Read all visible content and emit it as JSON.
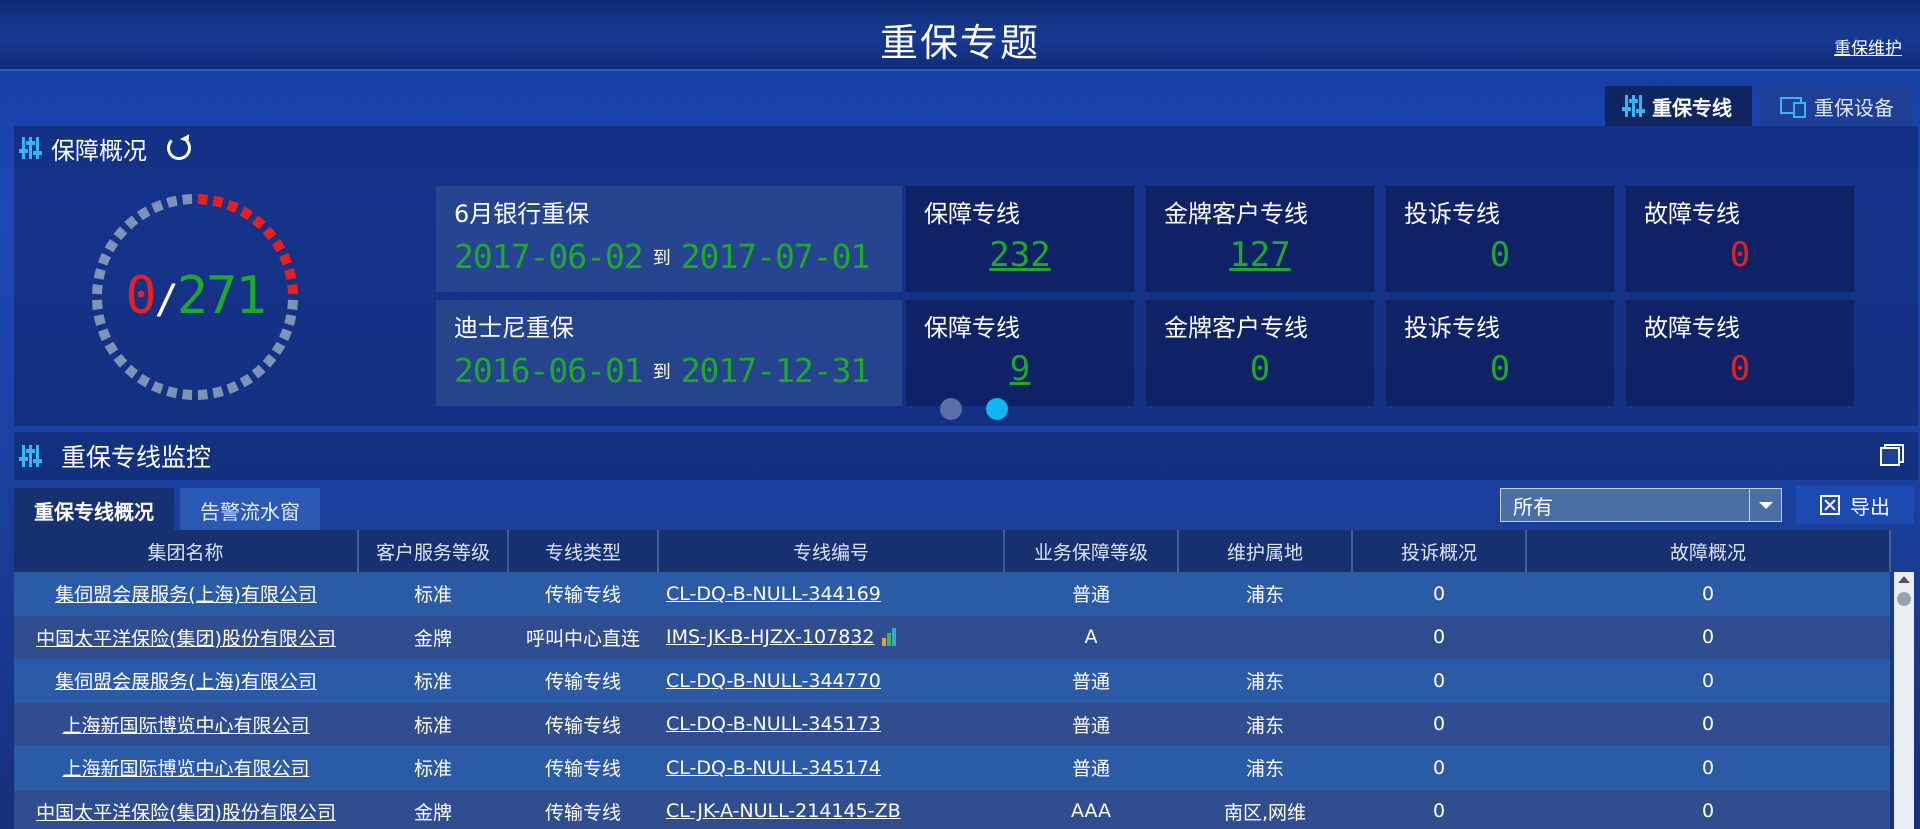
{
  "header": {
    "title": "重保专题",
    "maintenance_link": "重保维护"
  },
  "view_tabs": [
    {
      "label": "重保专线",
      "icon": "equalizer-icon",
      "active": true
    },
    {
      "label": "重保设备",
      "icon": "monitor-icon",
      "active": false
    }
  ],
  "overview": {
    "title": "保障概况",
    "gauge": {
      "current": "0",
      "separator": "/",
      "total": "271",
      "current_color": "#e42121",
      "total_color": "#1fa82b"
    },
    "rows": [
      {
        "name": "6月银行重保",
        "start": "2017-06-02",
        "to": "到",
        "end": "2017-07-01",
        "cards": [
          {
            "title": "保障专线",
            "value": "232",
            "link": true,
            "color": "green"
          },
          {
            "title": "金牌客户专线",
            "value": "127",
            "link": true,
            "color": "green"
          },
          {
            "title": "投诉专线",
            "value": "0",
            "link": false,
            "color": "green"
          },
          {
            "title": "故障专线",
            "value": "0",
            "link": false,
            "color": "red"
          }
        ]
      },
      {
        "name": "迪士尼重保",
        "start": "2016-06-01",
        "to": "到",
        "end": "2017-12-31",
        "cards": [
          {
            "title": "保障专线",
            "value": "9",
            "link": true,
            "color": "green"
          },
          {
            "title": "金牌客户专线",
            "value": "0",
            "link": false,
            "color": "green"
          },
          {
            "title": "投诉专线",
            "value": "0",
            "link": false,
            "color": "green"
          },
          {
            "title": "故障专线",
            "value": "0",
            "link": false,
            "color": "red"
          }
        ]
      }
    ],
    "pager": {
      "pages": 2,
      "active_page": 2
    }
  },
  "monitor": {
    "title": "重保专线监控",
    "tabs": [
      {
        "label": "重保专线概况",
        "active": true
      },
      {
        "label": "告警流水窗",
        "active": false
      }
    ],
    "filter": {
      "value": "所有"
    },
    "export_label": "导出",
    "columns": [
      "集团名称",
      "客户服务等级",
      "专线类型",
      "专线编号",
      "业务保障等级",
      "维护属地",
      "投诉概况",
      "故障概况"
    ],
    "rows": [
      [
        "集伺盟会展服务(上海)有限公司",
        "标准",
        "传输专线",
        "CL-DQ-B-NULL-344169",
        "普通",
        "浦东",
        "0",
        "0"
      ],
      [
        "中国太平洋保险(集团)股份有限公司",
        "金牌",
        "呼叫中心直连",
        "IMS-JK-B-HJZX-107832",
        "A",
        "",
        "0",
        "0"
      ],
      [
        "集伺盟会展服务(上海)有限公司",
        "标准",
        "传输专线",
        "CL-DQ-B-NULL-344770",
        "普通",
        "浦东",
        "0",
        "0"
      ],
      [
        "上海新国际博览中心有限公司",
        "标准",
        "传输专线",
        "CL-DQ-B-NULL-345173",
        "普通",
        "浦东",
        "0",
        "0"
      ],
      [
        "上海新国际博览中心有限公司",
        "标准",
        "传输专线",
        "CL-DQ-B-NULL-345174",
        "普通",
        "浦东",
        "0",
        "0"
      ],
      [
        "中国太平洋保险(集团)股份有限公司",
        "金牌",
        "传输专线",
        "CL-JK-A-NULL-214145-ZB",
        "AAA",
        "南区,网维",
        "0",
        "0"
      ]
    ],
    "chart_icon_row": 1
  },
  "colors": {
    "accent": "#0fb6f0",
    "ok": "#1fa82b",
    "alarm": "#e42121"
  }
}
